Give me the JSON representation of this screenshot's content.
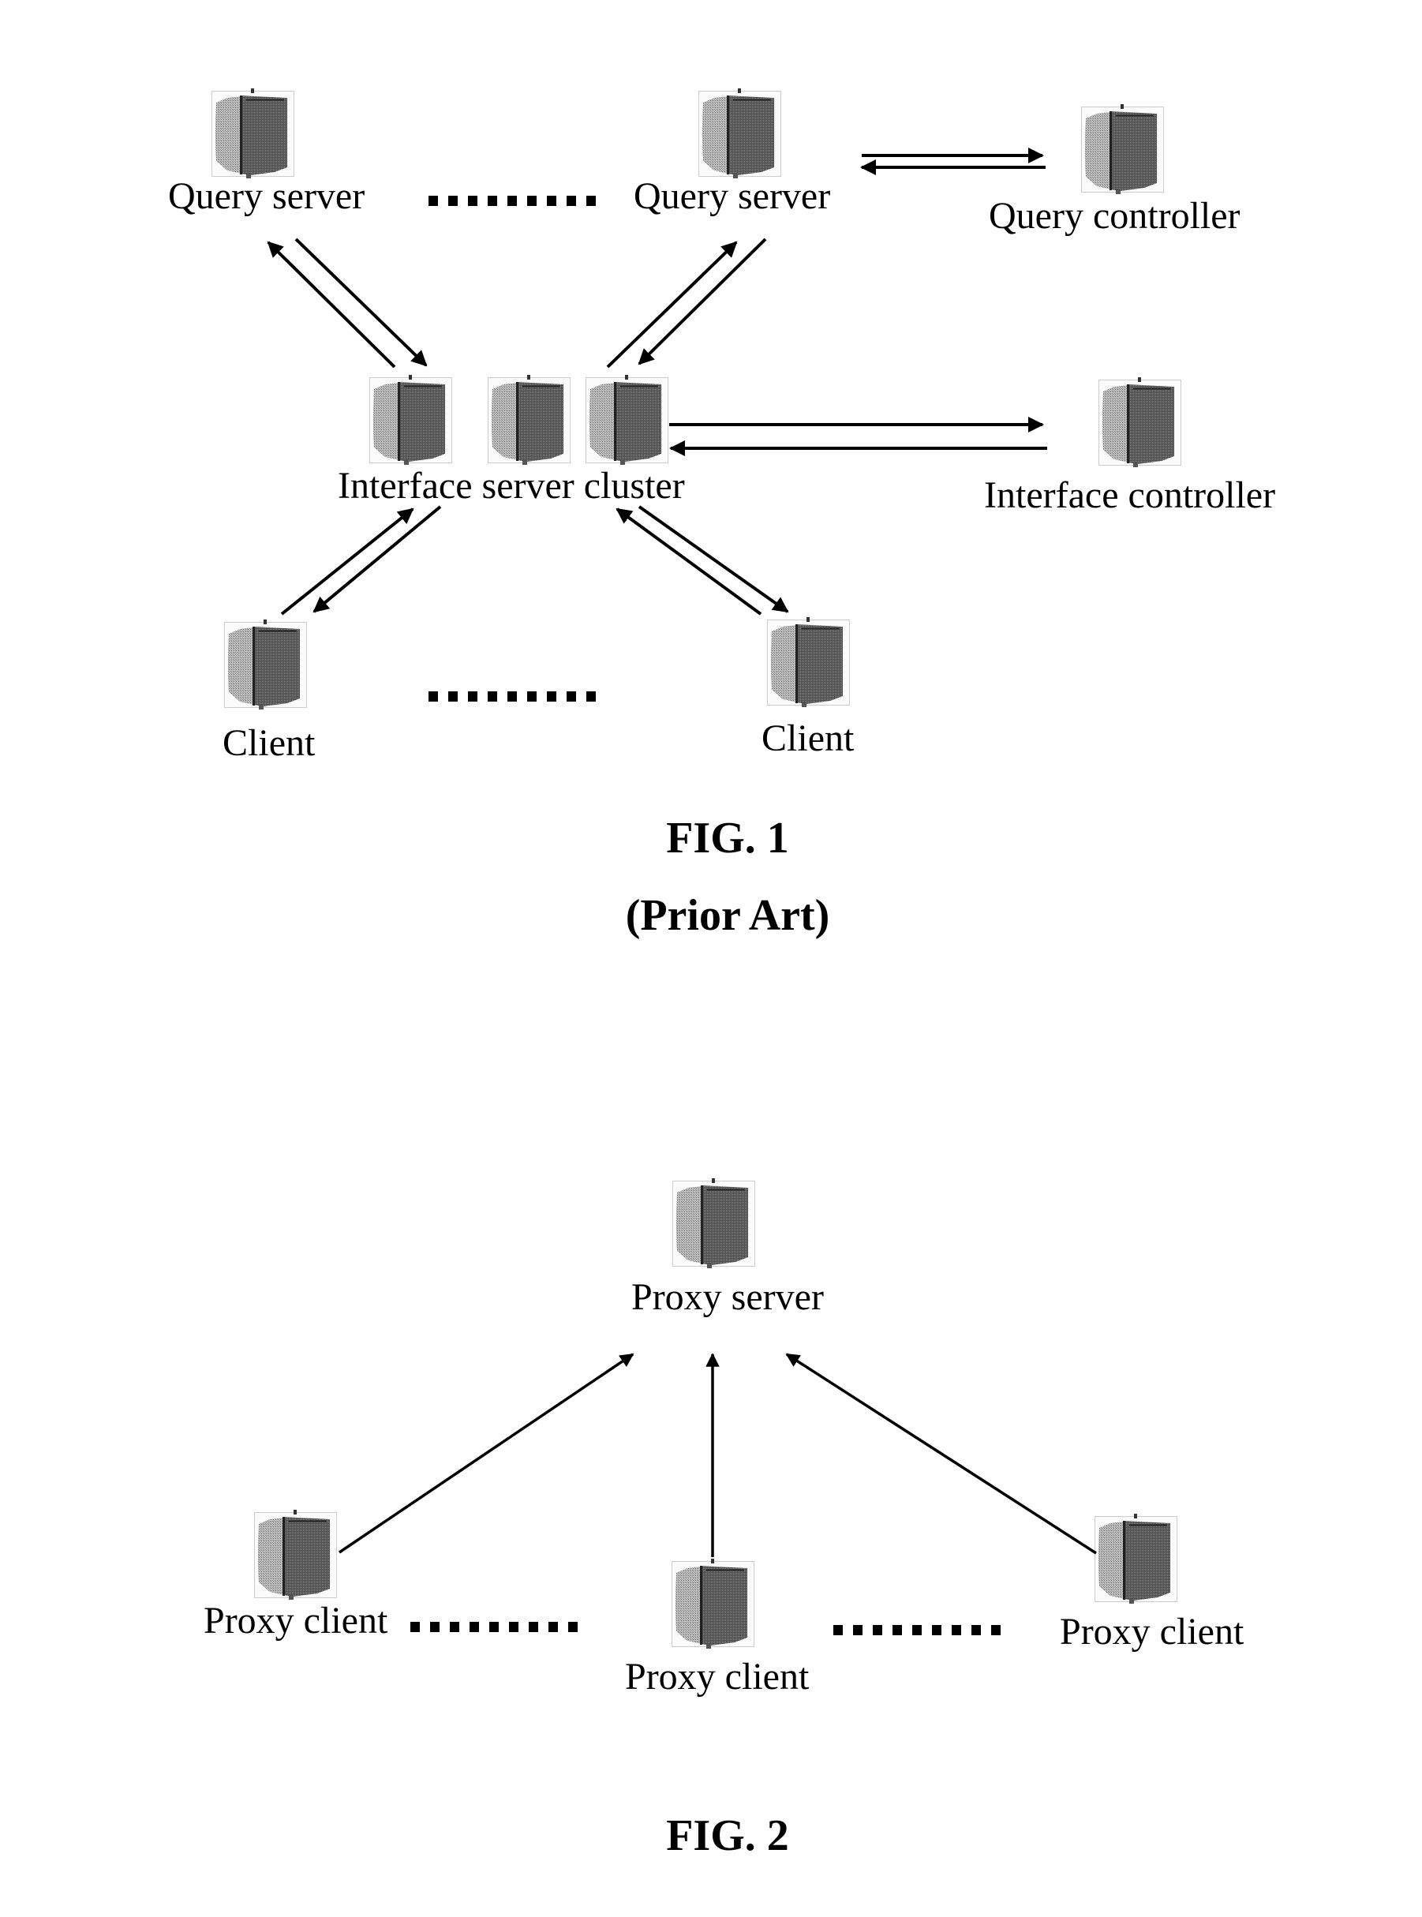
{
  "figures": [
    {
      "id": "fig1",
      "caption": "FIG. 1",
      "subcaption": "(Prior Art)",
      "nodes": {
        "query_server_1": "Query server",
        "query_server_2": "Query server",
        "query_controller": "Query controller",
        "interface_server_cluster": "Interface server cluster",
        "interface_controller": "Interface controller",
        "client_1": "Client",
        "client_2": "Client"
      },
      "edges": [
        {
          "from": "interface_server_cluster",
          "to": "query_server_1"
        },
        {
          "from": "query_server_1",
          "to": "interface_server_cluster"
        },
        {
          "from": "interface_server_cluster",
          "to": "query_server_2"
        },
        {
          "from": "query_server_2",
          "to": "interface_server_cluster"
        },
        {
          "from": "query_server_2",
          "to": "query_controller"
        },
        {
          "from": "query_controller",
          "to": "query_server_2"
        },
        {
          "from": "interface_server_cluster",
          "to": "interface_controller"
        },
        {
          "from": "interface_controller",
          "to": "interface_server_cluster"
        },
        {
          "from": "client_1",
          "to": "interface_server_cluster"
        },
        {
          "from": "interface_server_cluster",
          "to": "client_1"
        },
        {
          "from": "client_2",
          "to": "interface_server_cluster"
        },
        {
          "from": "interface_server_cluster",
          "to": "client_2"
        }
      ],
      "ellipsis_count": 2
    },
    {
      "id": "fig2",
      "caption": "FIG. 2",
      "nodes": {
        "proxy_server": "Proxy server",
        "proxy_client_1": "Proxy client",
        "proxy_client_2": "Proxy client",
        "proxy_client_3": "Proxy client"
      },
      "edges": [
        {
          "from": "proxy_client_1",
          "to": "proxy_server"
        },
        {
          "from": "proxy_client_2",
          "to": "proxy_server"
        },
        {
          "from": "proxy_client_3",
          "to": "proxy_server"
        }
      ],
      "ellipsis_count": 2
    }
  ],
  "icons": {
    "node": "server-tower-icon",
    "ellipsis": "ellipsis-dots"
  },
  "colors": {
    "ink": "#000000",
    "background": "#ffffff"
  }
}
